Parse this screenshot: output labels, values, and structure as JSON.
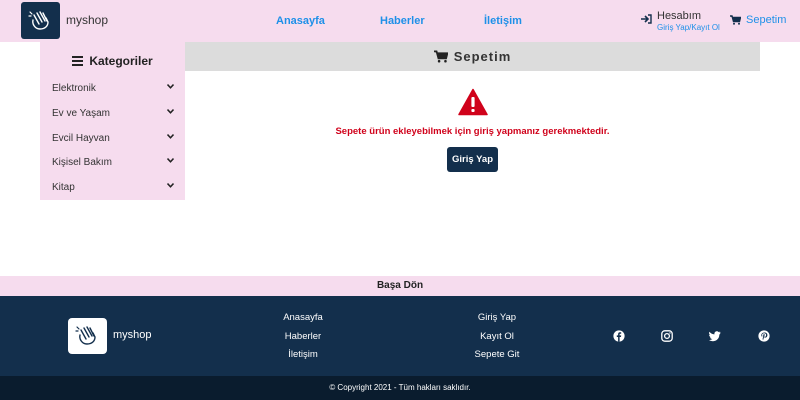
{
  "header": {
    "brand": "myshop",
    "nav": [
      "Anasayfa",
      "Haberler",
      "İletişim"
    ],
    "account_title": "Hesabım",
    "account_links": "Giriş Yap/Kayıt Ol",
    "cart_label": "Sepetim"
  },
  "sidebar": {
    "title": "Kategoriler",
    "items": [
      {
        "label": "Elektronik"
      },
      {
        "label": "Ev ve Yaşam"
      },
      {
        "label": "Evcil Hayvan"
      },
      {
        "label": "Kişisel Bakım"
      },
      {
        "label": "Kitap"
      }
    ]
  },
  "main": {
    "title": "Sepetim",
    "message": "Sepete ürün ekleyebilmek için giriş yapmanız gerekmektedir.",
    "login_button": "Giriş Yap"
  },
  "back_to_top": "Başa Dön",
  "footer": {
    "brand": "myshop",
    "col1": [
      "Anasayfa",
      "Haberler",
      "İletişim"
    ],
    "col2": [
      "Giriş Yap",
      "Kayıt Ol",
      "Sepete Git"
    ],
    "social_icons": [
      "facebook-icon",
      "instagram-icon",
      "twitter-icon",
      "pinterest-icon"
    ],
    "copyright": "© Copyright 2021 - Tüm hakları saklıdır."
  },
  "colors": {
    "accent": "#1e90e8",
    "navy": "#132f4c",
    "pink": "#f6dcee",
    "warning": "#d0021b"
  }
}
